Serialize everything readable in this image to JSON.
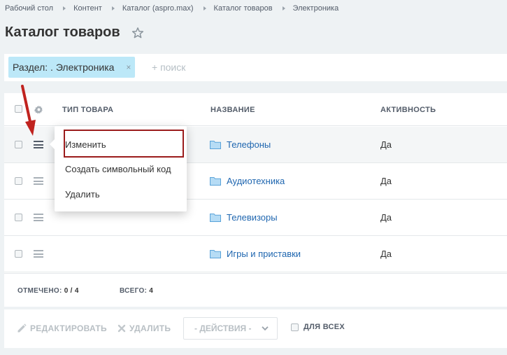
{
  "breadcrumb": [
    "Рабочий стол",
    "Контент",
    "Каталог (aspro.max)",
    "Каталог товаров",
    "Электроника"
  ],
  "page": {
    "title": "Каталог товаров",
    "favorite_icon": "star-outline-icon"
  },
  "filter": {
    "tag_label": "Раздел: . Электроника",
    "tag_close": "×",
    "search_placeholder": "+ поиск"
  },
  "grid": {
    "columns": {
      "type": "ТИП ТОВАРА",
      "name": "НАЗВАНИЕ",
      "active": "АКТИВНОСТЬ"
    },
    "rows": [
      {
        "type": "",
        "name": "Телефоны",
        "active": "Да"
      },
      {
        "type": "",
        "name": "Аудиотехника",
        "active": "Да"
      },
      {
        "type": "",
        "name": "Телевизоры",
        "active": "Да"
      },
      {
        "type": "",
        "name": "Игры и приставки",
        "active": "Да"
      }
    ],
    "footer": {
      "selected_label": "ОТМЕЧЕНО:",
      "selected_value": "0 / 4",
      "total_label": "ВСЕГО:",
      "total_value": "4"
    }
  },
  "context_menu": {
    "items": [
      "Изменить",
      "Создать символьный код",
      "Удалить"
    ]
  },
  "actions": {
    "edit_label": "РЕДАКТИРОВАТЬ",
    "delete_label": "УДАЛИТЬ",
    "select_label": "- ДЕЙСТВИЯ -",
    "for_all_label": "ДЛЯ ВСЕХ"
  },
  "colors": {
    "accent_link": "#2067b0",
    "filter_tag_bg": "#bce8f8",
    "highlight_border": "#9b1c1c",
    "arrow": "#c0231f"
  }
}
